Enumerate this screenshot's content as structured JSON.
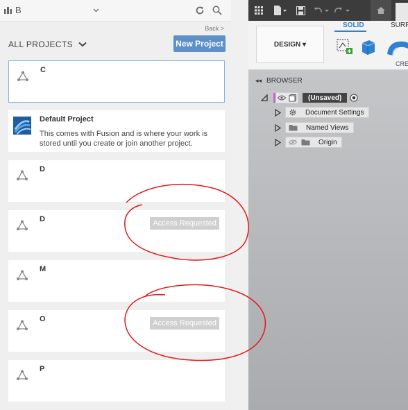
{
  "team": {
    "name": "B"
  },
  "header": {
    "back_label": "Back >",
    "all_projects_label": "ALL PROJECTS",
    "new_project_label": "New Project"
  },
  "projects": [
    {
      "title": "C"
    },
    {
      "title": "Default Project",
      "description": "This comes with Fusion and is where your work is stored until you create or join another project."
    },
    {
      "title": "D"
    },
    {
      "title": "D",
      "status": "Access Requested"
    },
    {
      "title": "M"
    },
    {
      "title": "O",
      "status": "Access Requested"
    },
    {
      "title": "P"
    }
  ],
  "toolbar": {
    "design_label": "DESIGN ▾",
    "tab_solid": "SOLID",
    "tab_surface": "SURF",
    "create_label": "CRE"
  },
  "browser": {
    "title": "BROWSER",
    "root": "(Unsaved)",
    "nodes": [
      "Document Settings",
      "Named Views",
      "Origin"
    ]
  },
  "colors": {
    "accent": "#5d90c7",
    "annotation": "#e31818",
    "solid_tab": "#2f80d0"
  }
}
